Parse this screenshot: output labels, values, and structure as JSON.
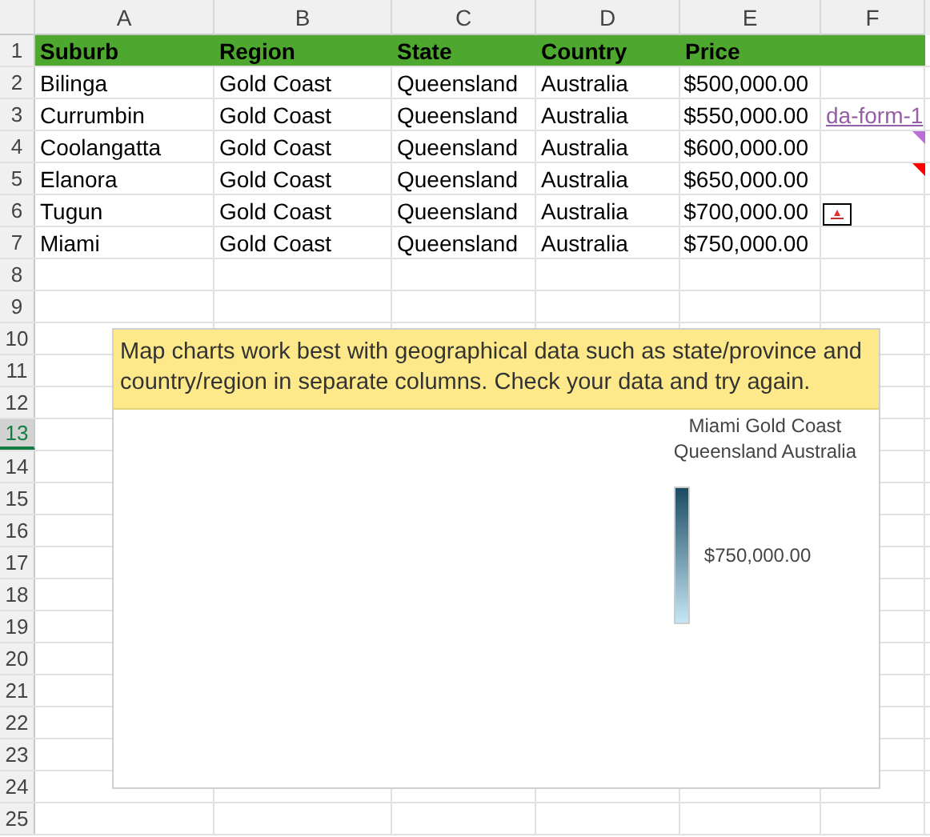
{
  "columns": [
    "A",
    "B",
    "C",
    "D",
    "E",
    "F"
  ],
  "rows": [
    {
      "number": "1",
      "selected": false,
      "kind": "header",
      "cells": [
        "Suburb",
        "Region",
        "State",
        "Country",
        "Price"
      ]
    },
    {
      "number": "2",
      "selected": false,
      "kind": "data",
      "cells": [
        "Bilinga",
        "Gold Coast",
        "Queensland",
        "Australia",
        "$500,000.00"
      ]
    },
    {
      "number": "3",
      "selected": false,
      "kind": "data",
      "cells": [
        "Currumbin",
        "Gold Coast",
        "Queensland",
        "Australia",
        "$550,000.00"
      ],
      "extra": {
        "kind": "link",
        "text": "da-form-1"
      }
    },
    {
      "number": "4",
      "selected": false,
      "kind": "data",
      "cells": [
        "Coolangatta",
        "Gold Coast",
        "Queensland",
        "Australia",
        "$600,000.00"
      ],
      "extra": {
        "kind": "note",
        "color": "#b86fd6"
      }
    },
    {
      "number": "5",
      "selected": false,
      "kind": "data",
      "cells": [
        "Elanora",
        "Gold Coast",
        "Queensland",
        "Australia",
        "$650,000.00"
      ],
      "extra": {
        "kind": "note",
        "color": "#ff0000"
      }
    },
    {
      "number": "6",
      "selected": false,
      "kind": "data",
      "cells": [
        "Tugun",
        "Gold Coast",
        "Queensland",
        "Australia",
        "$700,000.00"
      ],
      "extra": {
        "kind": "image"
      }
    },
    {
      "number": "7",
      "selected": false,
      "kind": "data",
      "cells": [
        "Miami",
        "Gold Coast",
        "Queensland",
        "Australia",
        "$750,000.00"
      ]
    },
    {
      "number": "8",
      "selected": false,
      "kind": "empty"
    },
    {
      "number": "9",
      "selected": false,
      "kind": "empty"
    },
    {
      "number": "10",
      "selected": false,
      "kind": "empty"
    },
    {
      "number": "11",
      "selected": false,
      "kind": "empty"
    },
    {
      "number": "12",
      "selected": false,
      "kind": "empty"
    },
    {
      "number": "13",
      "selected": true,
      "kind": "empty"
    },
    {
      "number": "14",
      "selected": false,
      "kind": "empty"
    },
    {
      "number": "15",
      "selected": false,
      "kind": "empty"
    },
    {
      "number": "16",
      "selected": false,
      "kind": "empty"
    },
    {
      "number": "17",
      "selected": false,
      "kind": "empty"
    },
    {
      "number": "18",
      "selected": false,
      "kind": "empty"
    },
    {
      "number": "19",
      "selected": false,
      "kind": "empty"
    },
    {
      "number": "20",
      "selected": false,
      "kind": "empty"
    },
    {
      "number": "21",
      "selected": false,
      "kind": "empty"
    },
    {
      "number": "22",
      "selected": false,
      "kind": "empty"
    },
    {
      "number": "23",
      "selected": false,
      "kind": "empty"
    },
    {
      "number": "24",
      "selected": false,
      "kind": "empty"
    },
    {
      "number": "25",
      "selected": false,
      "kind": "empty"
    }
  ],
  "chart": {
    "message": "Map charts work best with geographical data such as state/province and country/region in separate columns. Check your data and try again.",
    "legend_title": [
      "Miami Gold Coast",
      "Queensland Australia"
    ],
    "legend_value": "$750,000.00"
  }
}
